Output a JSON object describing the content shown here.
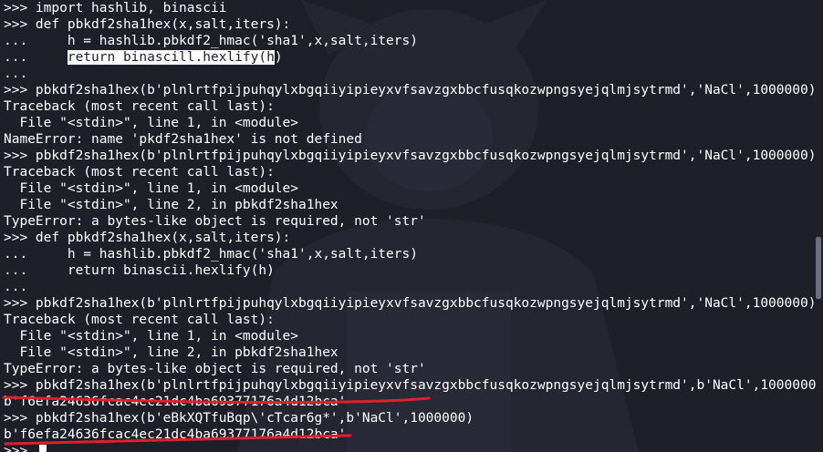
{
  "theme": {
    "background": "#1e1f29",
    "foreground": "#ffffff",
    "underline_color": "#e0202a",
    "selection_bg": "#ffffff"
  },
  "terminal": {
    "lines": [
      ">>> import hashlib, binascii",
      ">>> def pbkdf2sha1hex(x,salt,iters):",
      "...     h = hashlib.pbkdf2_hmac('sha1',x,salt,iters)",
      "...     ",
      "...",
      ">>> pbkdf2sha1hex(b'plnlrtfpijpuhqylxbgqiiyipieyxvfsavzgxbbcfusqkozwpngsyejqlmjsytrmd','NaCl',1000000)",
      "Traceback (most recent call last):",
      "  File \"<stdin>\", line 1, in <module>",
      "NameError: name 'pkdf2sha1hex' is not defined",
      ">>> pbkdf2sha1hex(b'plnlrtfpijpuhqylxbgqiiyipieyxvfsavzgxbbcfusqkozwpngsyejqlmjsytrmd','NaCl',1000000)",
      "Traceback (most recent call last):",
      "  File \"<stdin>\", line 1, in <module>",
      "  File \"<stdin>\", line 2, in pbkdf2sha1hex",
      "TypeError: a bytes-like object is required, not 'str'",
      ">>> def pbkdf2sha1hex(x,salt,iters):",
      "...     h = hashlib.pbkdf2_hmac('sha1',x,salt,iters)",
      "...     return binascii.hexlify(h)",
      "...",
      ">>> pbkdf2sha1hex(b'plnlrtfpijpuhqylxbgqiiyipieyxvfsavzgxbbcfusqkozwpngsyejqlmjsytrmd','NaCl',1000000)",
      "Traceback (most recent call last):",
      "  File \"<stdin>\", line 1, in <module>",
      "  File \"<stdin>\", line 2, in pbkdf2sha1hex",
      "TypeError: a bytes-like object is required, not 'str'",
      ">>> pbkdf2sha1hex(b'plnlrtfpijpuhqylxbgqiiyipieyxvfsavzgxbbcfusqkozwpngsyejqlmjsytrmd',b'NaCl',1000000",
      "b'f6efa24636fcac4ec21dc4ba69377176a4d12bca'",
      ">>> pbkdf2sha1hex(b'eBkXQTfuBqp\\'cTcar6g*',b'NaCl',1000000)",
      "b'f6efa24636fcac4ec21dc4ba69377176a4d12bca'",
      ">>> "
    ],
    "selected_line": {
      "prefix": "...     ",
      "selected": "return binascill.hexlify(h",
      "suffix": ")"
    }
  }
}
